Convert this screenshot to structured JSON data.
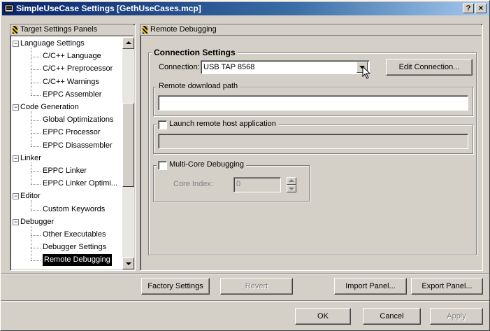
{
  "window": {
    "title": "SimpleUseCase Settings [GethUseCases.mcp]",
    "help_button": "?",
    "close_button": "×"
  },
  "left_panel": {
    "header": "Target Settings Panels",
    "tree": [
      {
        "label": "Language Settings",
        "level": 0,
        "expander": "−"
      },
      {
        "label": "C/C++ Language",
        "level": 1
      },
      {
        "label": "C/C++ Preprocessor",
        "level": 1
      },
      {
        "label": "C/C++ Warnings",
        "level": 1
      },
      {
        "label": "EPPC Assembler",
        "level": 1
      },
      {
        "label": "Code Generation",
        "level": 0,
        "expander": "−"
      },
      {
        "label": "Global Optimizations",
        "level": 1
      },
      {
        "label": "EPPC Processor",
        "level": 1
      },
      {
        "label": "EPPC Disassembler",
        "level": 1
      },
      {
        "label": "Linker",
        "level": 0,
        "expander": "−"
      },
      {
        "label": "EPPC Linker",
        "level": 1
      },
      {
        "label": "EPPC Linker Optimi...",
        "level": 1
      },
      {
        "label": "Editor",
        "level": 0,
        "expander": "−"
      },
      {
        "label": "Custom Keywords",
        "level": 1
      },
      {
        "label": "Debugger",
        "level": 0,
        "expander": "−"
      },
      {
        "label": "Other Executables",
        "level": 1
      },
      {
        "label": "Debugger Settings",
        "level": 1
      },
      {
        "label": "Remote Debugging",
        "level": 1,
        "selected": true
      }
    ]
  },
  "right_panel": {
    "header": "Remote Debugging",
    "connection_group": "Connection Settings",
    "connection_label": "Connection:",
    "connection_value": "USB TAP 8568",
    "edit_connection": "Edit Connection...",
    "remote_download_group": "Remote download path",
    "remote_download_value": "",
    "launch_remote_label": "Launch remote host application",
    "launch_remote_value": "",
    "multicore_label": "Multi-Core Debugging",
    "core_index_label": "Core Index:",
    "core_index_value": "0"
  },
  "bottom_buttons": {
    "factory_settings": "Factory Settings",
    "revert": "Revert",
    "import_panel": "Import Panel...",
    "export_panel": "Export Panel...",
    "ok": "OK",
    "cancel": "Cancel",
    "apply": "Apply"
  },
  "colors": {
    "face": "#d4d0c8",
    "title_active": "#0a246a",
    "selection": "#000000"
  }
}
